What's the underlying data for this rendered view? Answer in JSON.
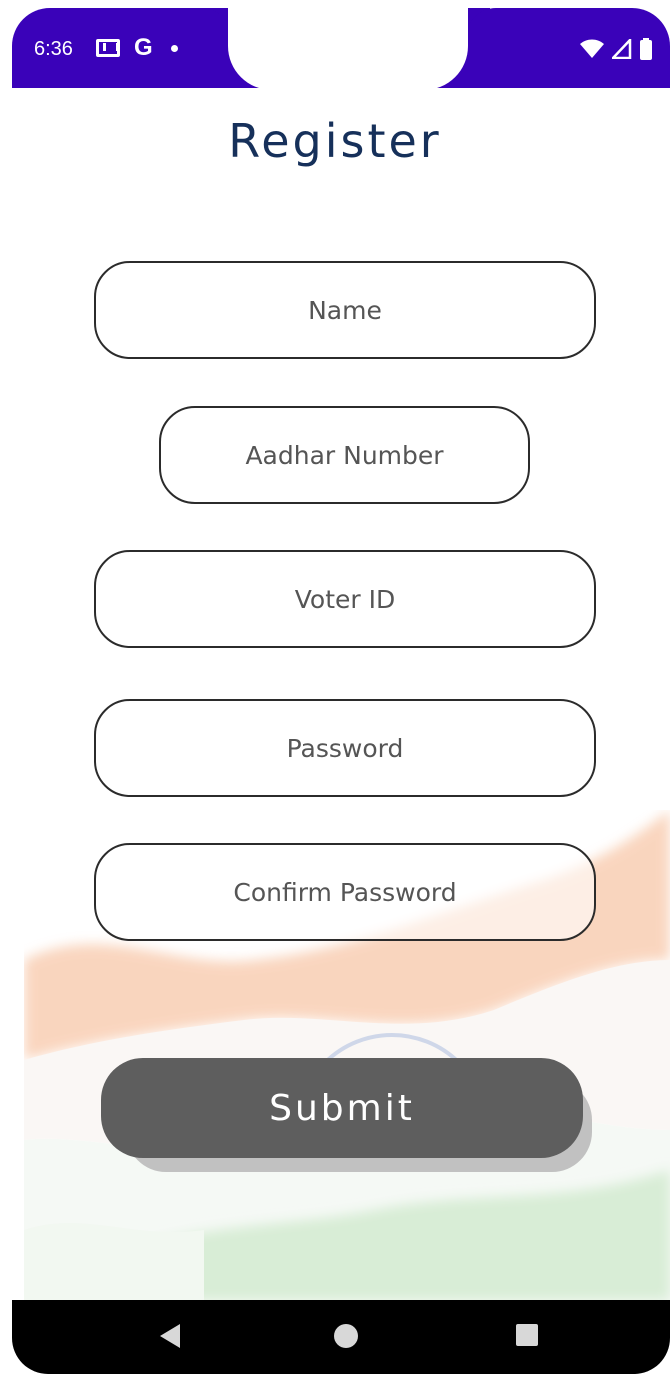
{
  "status_bar": {
    "time": "6:36",
    "left_icons": [
      "gmail-icon",
      "google-icon",
      "notification-dot-icon"
    ],
    "right_icons": [
      "wifi-icon",
      "signal-icon",
      "battery-icon"
    ],
    "color": "#3a02b9"
  },
  "page": {
    "title": "Register"
  },
  "form": {
    "name_placeholder": "Name",
    "aadhar_placeholder": "Aadhar Number",
    "voter_placeholder": "Voter ID",
    "password_placeholder": "Password",
    "confirm_placeholder": "Confirm Password",
    "submit_label": "Submit"
  },
  "colors": {
    "title": "#16305a",
    "button": "#5e5e5e",
    "field_border": "#2b2b2b"
  },
  "nav_bar": {
    "icons": [
      "back-icon",
      "home-icon",
      "recents-icon"
    ]
  }
}
